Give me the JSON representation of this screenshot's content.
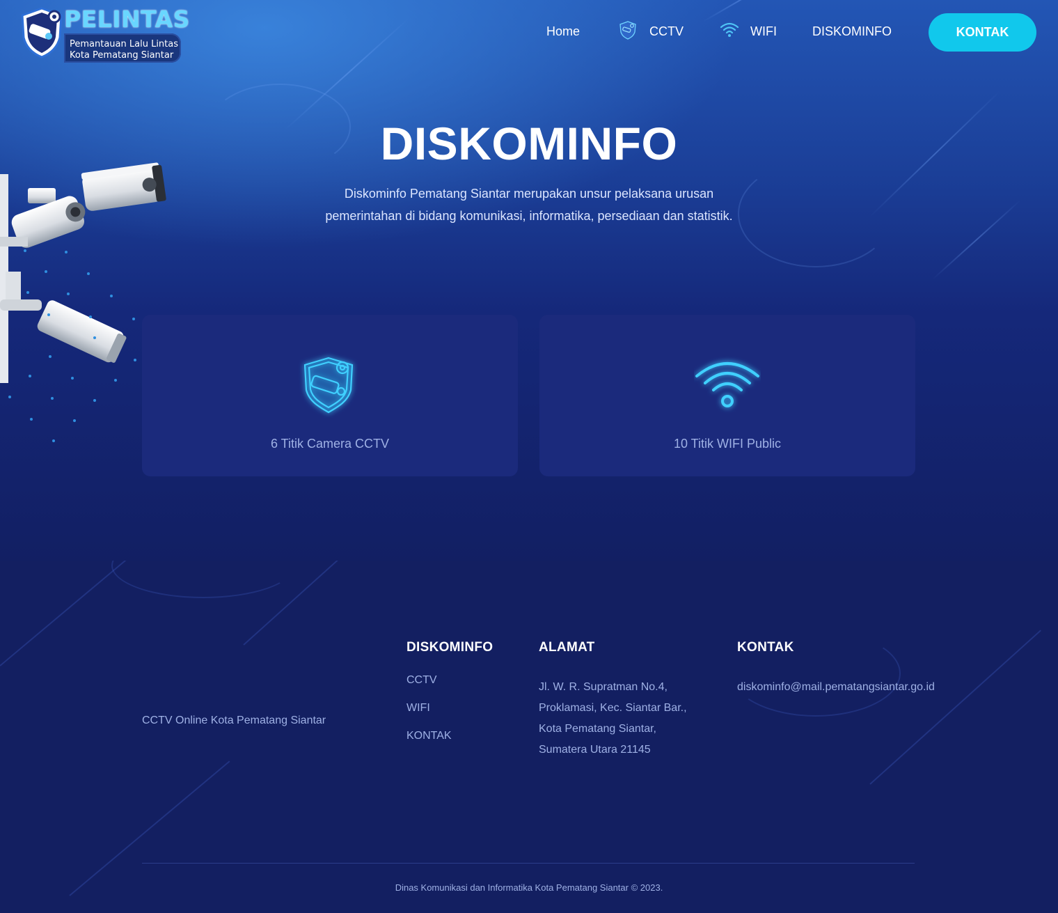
{
  "header": {
    "logo": {
      "brand": "PELINTAS",
      "tagline_1": "Pemantauan Lalu Lintas",
      "tagline_2": "Kota Pematang Siantar"
    },
    "nav": [
      {
        "label": "Home",
        "icon": null
      },
      {
        "label": "CCTV",
        "icon": "cctv-shield-icon"
      },
      {
        "label": "WIFI",
        "icon": "wifi-icon"
      },
      {
        "label": "DISKOMINFO",
        "icon": null
      }
    ],
    "cta_label": "KONTAK"
  },
  "hero": {
    "title": "DISKOMINFO",
    "description_line_1": "Diskominfo Pematang Siantar merupakan unsur pelaksana urusan",
    "description_line_2": "pemerintahan di bidang komunikasi, informatika, persediaan dan statistik."
  },
  "stats": [
    {
      "label": "6 Titik Camera CCTV",
      "icon": "cctv-shield-icon"
    },
    {
      "label": "10 Titik WIFI Public",
      "icon": "wifi-icon"
    }
  ],
  "footer": {
    "tagline": "CCTV Online Kota Pematang Siantar",
    "col_links": {
      "heading": "DISKOMINFO",
      "links": [
        "CCTV",
        "WIFI",
        "KONTAK"
      ]
    },
    "col_address": {
      "heading": "ALAMAT",
      "lines": [
        "Jl. W. R. Supratman No.4,",
        "Proklamasi, Kec. Siantar Bar.,",
        "Kota Pematang Siantar,",
        "Sumatera Utara 21145"
      ]
    },
    "col_contact": {
      "heading": "KONTAK",
      "email": "diskominfo@mail.pematangsiantar.go.id"
    },
    "copyright": "Dinas Komunikasi dan Informatika Kota Pematang Siantar © 2023."
  },
  "colors": {
    "accent": "#11c8ec",
    "hero_top": "#2356b5",
    "hero_bottom": "#121f63",
    "card": "#1b2a7c",
    "footer": "#131f61",
    "muted_text": "#9fb1e5"
  }
}
